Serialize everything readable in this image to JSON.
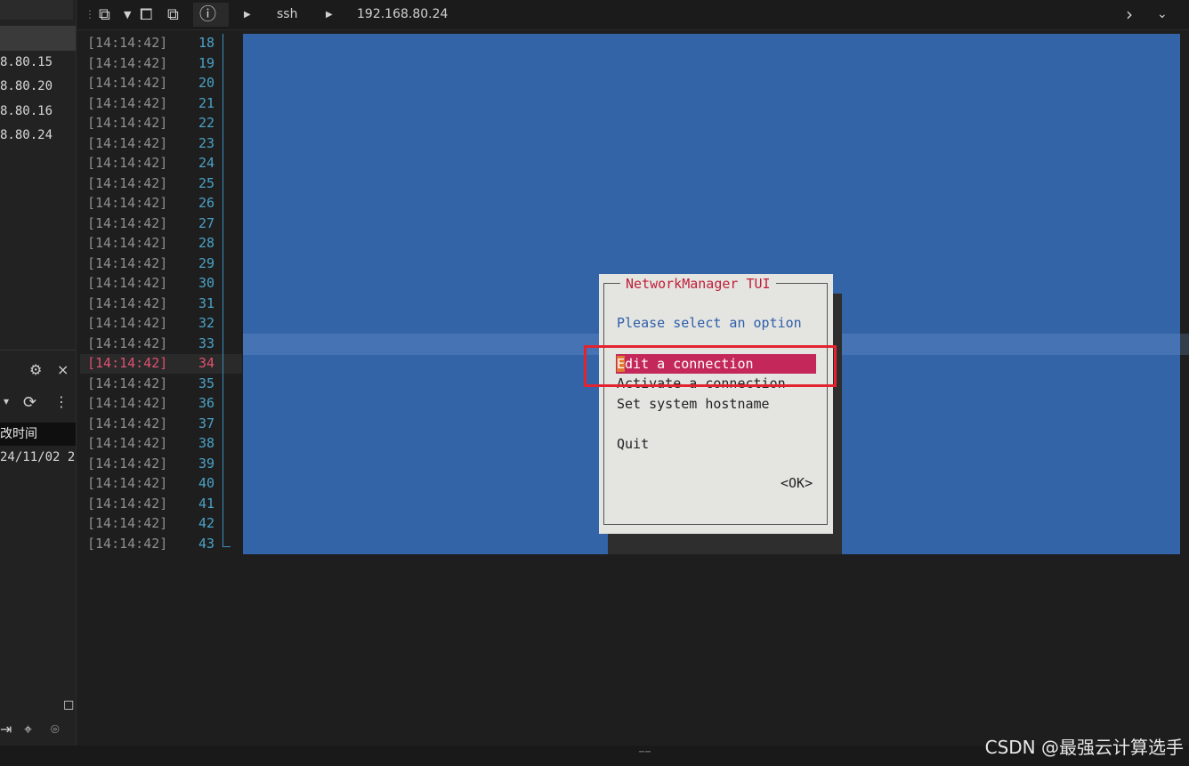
{
  "sidebar": {
    "hosts": [
      "8.80.15",
      "8.80.20",
      "8.80.16",
      "8.80.24"
    ],
    "column_header": "改时间",
    "date_value": "24/11/02 2",
    "icons": [
      "settings-icon",
      "close-icon",
      "dropdown-icon",
      "refresh-icon",
      "more-icon",
      "login-icon",
      "location-pin-icon",
      "map-pin-icon"
    ]
  },
  "toolbar": {
    "session_type": "ssh",
    "host": "192.168.80.24"
  },
  "log": {
    "timestamps": [
      "[14:14:42]",
      "[14:14:42]",
      "[14:14:42]",
      "[14:14:42]",
      "[14:14:42]",
      "[14:14:42]",
      "[14:14:42]",
      "[14:14:42]",
      "[14:14:42]",
      "[14:14:42]",
      "[14:14:42]",
      "[14:14:42]",
      "[14:14:42]",
      "[14:14:42]",
      "[14:14:42]",
      "[14:14:42]",
      "[14:14:42]",
      "[14:14:42]",
      "[14:14:42]",
      "[14:14:42]",
      "[14:14:42]",
      "[14:14:42]",
      "[14:14:42]",
      "[14:14:42]",
      "[14:14:42]",
      "[14:14:42]"
    ],
    "line_numbers": [
      "18",
      "19",
      "20",
      "21",
      "22",
      "23",
      "24",
      "25",
      "26",
      "27",
      "28",
      "29",
      "30",
      "31",
      "32",
      "33",
      "34",
      "35",
      "36",
      "37",
      "38",
      "39",
      "40",
      "41",
      "42",
      "43"
    ],
    "active_line": "34"
  },
  "dialog": {
    "title": "NetworkManager TUI",
    "prompt": "Please select an option",
    "options": [
      "Edit a connection",
      "Activate a connection",
      "Set system hostname",
      "",
      "Quit"
    ],
    "selected_option": "Edit a connection",
    "ok_button": "<OK>"
  },
  "watermark": "CSDN @最强云计算选手",
  "colors": {
    "terminal_bg": "#3464a8",
    "dialog_bg": "#e4e4e0",
    "selection": "#c4285a",
    "title": "#c0203a",
    "annotation_box": "#e3232f"
  }
}
